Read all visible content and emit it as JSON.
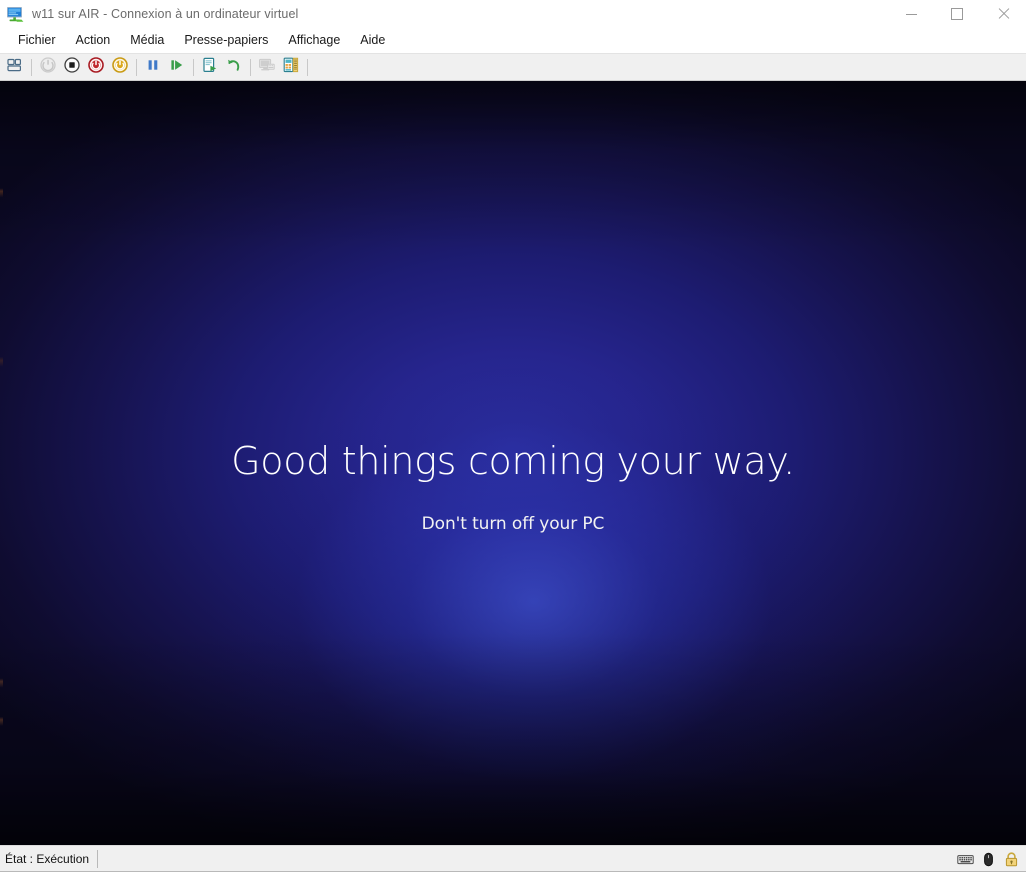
{
  "window": {
    "title": "w11 sur AIR - Connexion à un ordinateur virtuel",
    "icon": "virtual-machine-monitor-icon",
    "controls": {
      "minimize": "Réduire",
      "maximize": "Agrandir",
      "close": "Fermer"
    }
  },
  "menubar": {
    "items": [
      {
        "label": "Fichier"
      },
      {
        "label": "Action"
      },
      {
        "label": "Média"
      },
      {
        "label": "Presse-papiers"
      },
      {
        "label": "Affichage"
      },
      {
        "label": "Aide"
      }
    ]
  },
  "toolbar": {
    "buttons": [
      {
        "name": "ctrl-alt-del-icon",
        "title": "Ctrl+Alt+Suppr",
        "enabled": true
      },
      {
        "name": "start-icon",
        "title": "Démarrer",
        "enabled": false
      },
      {
        "name": "stop-icon",
        "title": "Arrêter",
        "enabled": true
      },
      {
        "name": "shutdown-icon",
        "title": "Arrêt",
        "enabled": true
      },
      {
        "name": "power-off-icon",
        "title": "Mettre hors tension",
        "enabled": true
      },
      {
        "name": "pause-icon",
        "title": "Suspendre",
        "enabled": true
      },
      {
        "name": "resume-icon",
        "title": "Reprendre",
        "enabled": true
      },
      {
        "name": "checkpoint-icon",
        "title": "Point de contrôle",
        "enabled": true
      },
      {
        "name": "revert-icon",
        "title": "Rétablir",
        "enabled": true
      },
      {
        "name": "basic-session-icon",
        "title": "Session de base",
        "enabled": false
      },
      {
        "name": "enhanced-session-icon",
        "title": "Session étendue",
        "enabled": true
      }
    ]
  },
  "vm_screen": {
    "headline": "Good things coming your way.",
    "subtext": "Don't turn off your PC",
    "background_center_color": "#2b2ea0",
    "background_edge_color": "#0a0820",
    "text_color": "#ffffff"
  },
  "statusbar": {
    "state_label": "État : Exécution",
    "icons": [
      {
        "name": "keyboard-icon",
        "title": "Clavier capturé"
      },
      {
        "name": "mouse-icon",
        "title": "Souris capturée"
      },
      {
        "name": "lock-icon",
        "title": "Session verrouillée"
      }
    ]
  }
}
